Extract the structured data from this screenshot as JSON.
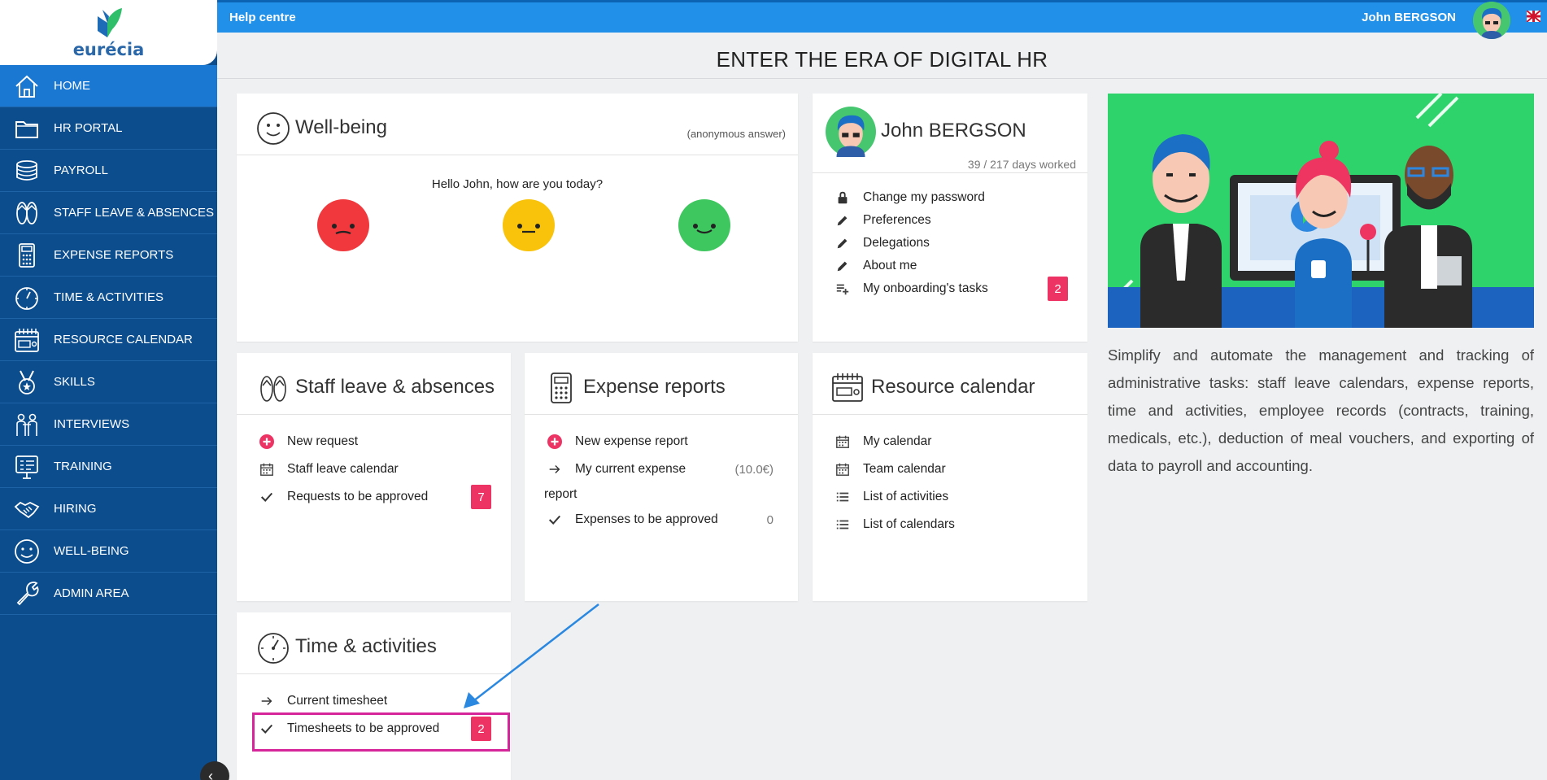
{
  "brand": {
    "name": "eurécia"
  },
  "sidebar": {
    "items": [
      {
        "label": "HOME",
        "icon": "home-icon"
      },
      {
        "label": "HR PORTAL",
        "icon": "folder-icon"
      },
      {
        "label": "PAYROLL",
        "icon": "coins-icon"
      },
      {
        "label": "STAFF LEAVE & ABSENCES",
        "icon": "flip-flops-icon"
      },
      {
        "label": "EXPENSE REPORTS",
        "icon": "calculator-icon"
      },
      {
        "label": "TIME & ACTIVITIES",
        "icon": "stopwatch-icon"
      },
      {
        "label": "RESOURCE CALENDAR",
        "icon": "calendar-icon"
      },
      {
        "label": "SKILLS",
        "icon": "medal-icon"
      },
      {
        "label": "INTERVIEWS",
        "icon": "people-icon"
      },
      {
        "label": "TRAINING",
        "icon": "presentation-icon"
      },
      {
        "label": "HIRING",
        "icon": "handshake-icon"
      },
      {
        "label": "WELL-BEING",
        "icon": "smiley-icon"
      },
      {
        "label": "ADMIN AREA",
        "icon": "wrench-icon"
      }
    ],
    "active_index": 0
  },
  "topbar": {
    "help": "Help centre",
    "user": "John  BERGSON"
  },
  "page_title": "ENTER THE ERA OF DIGITAL HR",
  "wellbeing": {
    "title": "Well-being",
    "anon": "(anonymous answer)",
    "greeting": "Hello John, how are you today?",
    "faces": [
      {
        "mood": "sad",
        "color": "#f0383d"
      },
      {
        "mood": "neutral",
        "color": "#f8c30a"
      },
      {
        "mood": "happy",
        "color": "#3fc75f"
      }
    ]
  },
  "profile": {
    "name": "John BERGSON",
    "days": "39 / 217 days worked",
    "items": [
      {
        "label": "Change my password",
        "icon": "lock-icon"
      },
      {
        "label": "Preferences",
        "icon": "pencil-icon"
      },
      {
        "label": "Delegations",
        "icon": "pencil-icon"
      },
      {
        "label": "About me",
        "icon": "pencil-icon"
      },
      {
        "label": "My onboarding's tasks",
        "icon": "playlist-add-icon",
        "badge": "2"
      }
    ]
  },
  "leave": {
    "title": "Staff leave & absences",
    "items": [
      {
        "label": "New request",
        "icon": "plus-circle-icon"
      },
      {
        "label": "Staff leave calendar",
        "icon": "calendar-icon"
      },
      {
        "label": "Requests to be approved",
        "icon": "check-icon",
        "badge": "7"
      }
    ]
  },
  "expense": {
    "title": "Expense reports",
    "items": [
      {
        "label": "New expense report",
        "icon": "plus-circle-icon"
      },
      {
        "label": "My current expense",
        "label2": "report",
        "icon": "arrow-right-icon",
        "count": "(10.0€)"
      },
      {
        "label": "Expenses to be approved",
        "icon": "check-icon",
        "count": "0"
      }
    ]
  },
  "resource": {
    "title": "Resource calendar",
    "items": [
      {
        "label": "My calendar",
        "icon": "calendar-icon"
      },
      {
        "label": "Team calendar",
        "icon": "calendar-icon"
      },
      {
        "label": "List of activities",
        "icon": "list-icon"
      },
      {
        "label": "List of calendars",
        "icon": "list-icon"
      }
    ]
  },
  "time": {
    "title": "Time & activities",
    "items": [
      {
        "label": "Current timesheet",
        "icon": "arrow-right-icon"
      },
      {
        "label": "Timesheets to be approved",
        "icon": "check-icon",
        "badge": "2"
      }
    ]
  },
  "promo": {
    "text": "Simplify and automate the management and tracking of administrative tasks: staff leave calendars, expense reports, time and activities, employee records (contracts, training, medicals, etc.), deduction of meal vouchers, and exporting of data to payroll and accounting."
  },
  "colors": {
    "sidebar": "#0c4d8e",
    "active": "#1a78d2",
    "topbar": "#2190e8",
    "badge": "#ec3363",
    "highlight": "#d6259a",
    "arrow": "#2b88e0"
  }
}
